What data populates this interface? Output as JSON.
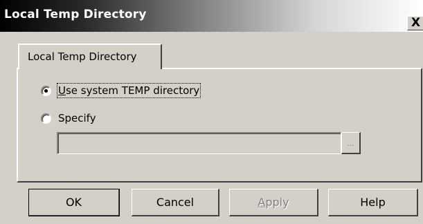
{
  "window": {
    "title": "Local Temp Directory",
    "close_glyph": "X"
  },
  "tab": {
    "label": "Local Temp Directory"
  },
  "options": {
    "system_temp": {
      "label_prefix": "U",
      "label_rest": "se system TEMP directory",
      "checked": true
    },
    "specify": {
      "label": "Specify",
      "checked": false
    }
  },
  "path_field": {
    "value": "",
    "enabled": false
  },
  "browse_button": {
    "label": "..."
  },
  "buttons": {
    "ok": "OK",
    "cancel": "Cancel",
    "apply_prefix": "A",
    "apply_rest": "pply",
    "help": "Help"
  }
}
